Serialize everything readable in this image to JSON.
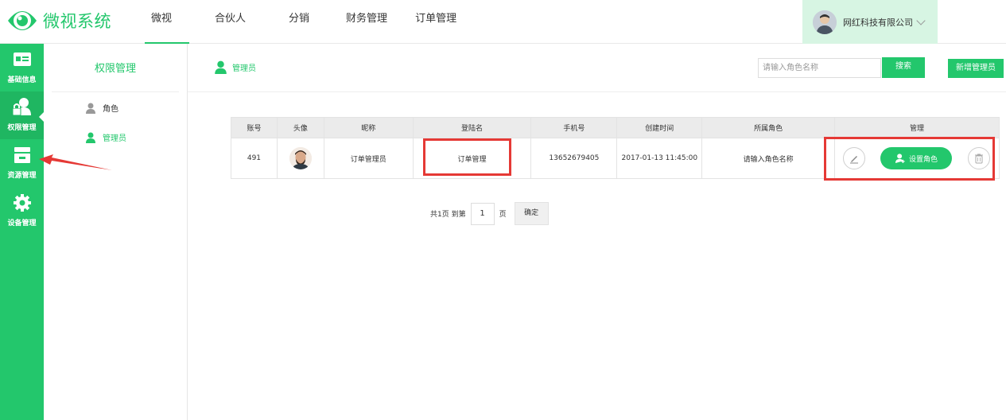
{
  "app": {
    "name": "微视系统",
    "brand_color": "#23c76c"
  },
  "topnav": [
    "微视",
    "合伙人",
    "分销",
    "财务管理",
    "订单管理"
  ],
  "user": {
    "company": "网红科技有限公司"
  },
  "rail": [
    {
      "label": "基础信息",
      "icon": "id-card-icon"
    },
    {
      "label": "权限管理",
      "icon": "user-lock-icon"
    },
    {
      "label": "资源管理",
      "icon": "drawer-icon"
    },
    {
      "label": "设备管理",
      "icon": "gear-icon"
    }
  ],
  "sidebar": {
    "title": "权限管理",
    "items": [
      {
        "label": "角色",
        "active": false
      },
      {
        "label": "管理员",
        "active": true
      }
    ]
  },
  "breadcrumb": "管理员",
  "search": {
    "placeholder": "请输入角色名称",
    "button": "搜索"
  },
  "add_button": "新增管理员",
  "table": {
    "headers": [
      "账号",
      "头像",
      "昵称",
      "登陆名",
      "手机号",
      "创建时间",
      "所属角色",
      "管理"
    ],
    "rows": [
      {
        "account": "491",
        "nickname": "订单管理员",
        "login": "订单管理",
        "phone": "13652679405",
        "created": "2017-01-13 11:45:00",
        "role": "请输入角色名称",
        "role_button": "设置角色"
      }
    ]
  },
  "pager": {
    "total": "共1页 到第",
    "page": "1",
    "unit": "页",
    "confirm": "确定"
  },
  "highlight_color": "#e53935"
}
